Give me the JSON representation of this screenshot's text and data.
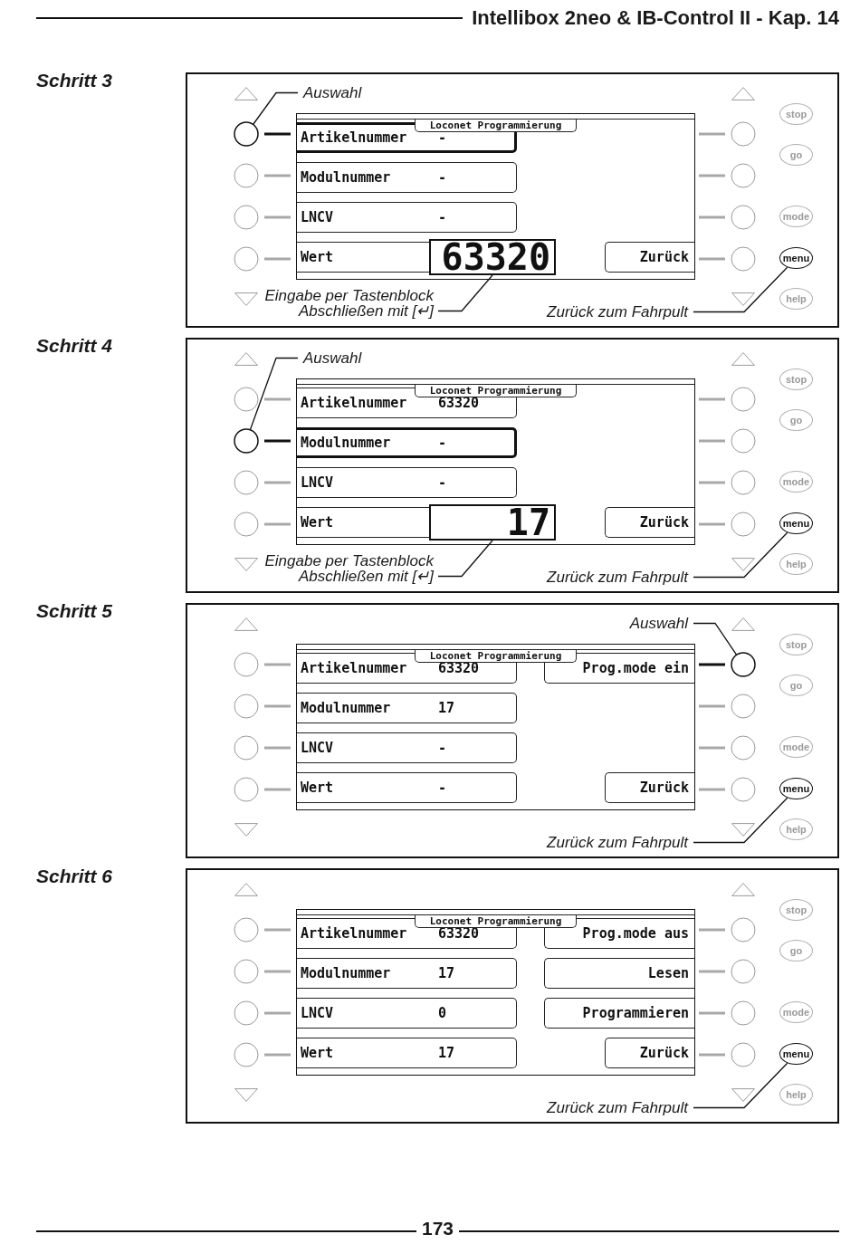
{
  "header": {
    "title": "Intellibox 2neo & IB-Control II - Kap. 14"
  },
  "steps": [
    {
      "label": "Schritt 3",
      "screen": {
        "title": "Loconet Programmierung",
        "rows": [
          {
            "kind": "field",
            "label": "Artikelnummer",
            "value": "-",
            "selected": true
          },
          {
            "kind": "field",
            "label": "Modulnummer",
            "value": "-",
            "selected": false
          },
          {
            "kind": "field",
            "label": "LNCV",
            "value": "-",
            "selected": false
          },
          {
            "kind": "entry",
            "label": "Wert",
            "value": "63320",
            "selected": false
          }
        ],
        "softkeys": [
          {
            "kind": "empty"
          },
          {
            "kind": "empty"
          },
          {
            "kind": "empty"
          },
          {
            "kind": "back",
            "label": "Zurück"
          }
        ]
      },
      "left_keys": [
        {
          "highlighted": true
        },
        {
          "highlighted": false
        },
        {
          "highlighted": false
        },
        {
          "highlighted": false
        }
      ],
      "right_keys": [
        {
          "highlighted": false
        },
        {
          "highlighted": false
        },
        {
          "highlighted": false
        },
        {
          "highlighted": false
        }
      ],
      "side_buttons": [
        {
          "label": "stop",
          "highlighted": false
        },
        {
          "label": "go",
          "highlighted": false
        },
        {
          "label": "mode",
          "highlighted": false
        },
        {
          "label": "menu",
          "highlighted": true
        },
        {
          "label": "help",
          "highlighted": false
        }
      ],
      "callouts": [
        {
          "kind": "selection",
          "text": "Auswahl"
        },
        {
          "kind": "entry",
          "lines": [
            "Eingabe per Tastenblock",
            "Abschließen mit [↵]"
          ]
        },
        {
          "kind": "exit",
          "text": "Zurück zum Fahrpult"
        }
      ]
    },
    {
      "label": "Schritt 4",
      "screen": {
        "title": "Loconet Programmierung",
        "rows": [
          {
            "kind": "field",
            "label": "Artikelnummer",
            "value": "63320",
            "selected": false
          },
          {
            "kind": "field",
            "label": "Modulnummer",
            "value": "-",
            "selected": true
          },
          {
            "kind": "field",
            "label": "LNCV",
            "value": "-",
            "selected": false
          },
          {
            "kind": "entry",
            "label": "Wert",
            "value": "17",
            "selected": false
          }
        ],
        "softkeys": [
          {
            "kind": "empty"
          },
          {
            "kind": "empty"
          },
          {
            "kind": "empty"
          },
          {
            "kind": "back",
            "label": "Zurück"
          }
        ]
      },
      "left_keys": [
        {
          "highlighted": false
        },
        {
          "highlighted": true
        },
        {
          "highlighted": false
        },
        {
          "highlighted": false
        }
      ],
      "right_keys": [
        {
          "highlighted": false
        },
        {
          "highlighted": false
        },
        {
          "highlighted": false
        },
        {
          "highlighted": false
        }
      ],
      "side_buttons": [
        {
          "label": "stop",
          "highlighted": false
        },
        {
          "label": "go",
          "highlighted": false
        },
        {
          "label": "mode",
          "highlighted": false
        },
        {
          "label": "menu",
          "highlighted": true
        },
        {
          "label": "help",
          "highlighted": false
        }
      ],
      "callouts": [
        {
          "kind": "selection",
          "text": "Auswahl"
        },
        {
          "kind": "entry",
          "lines": [
            "Eingabe per Tastenblock",
            "Abschließen mit [↵]"
          ]
        },
        {
          "kind": "exit",
          "text": "Zurück zum Fahrpult"
        }
      ]
    },
    {
      "label": "Schritt 5",
      "screen": {
        "title": "Loconet Programmierung",
        "rows": [
          {
            "kind": "field",
            "label": "Artikelnummer",
            "value": "63320",
            "selected": false
          },
          {
            "kind": "field",
            "label": "Modulnummer",
            "value": "17",
            "selected": false
          },
          {
            "kind": "field",
            "label": "LNCV",
            "value": "-",
            "selected": false
          },
          {
            "kind": "field",
            "label": "Wert",
            "value": "-",
            "selected": false
          }
        ],
        "softkeys": [
          {
            "kind": "action",
            "label": "Prog.mode ein"
          },
          {
            "kind": "empty"
          },
          {
            "kind": "empty"
          },
          {
            "kind": "back",
            "label": "Zurück"
          }
        ]
      },
      "left_keys": [
        {
          "highlighted": false
        },
        {
          "highlighted": false
        },
        {
          "highlighted": false
        },
        {
          "highlighted": false
        }
      ],
      "right_keys": [
        {
          "highlighted": true
        },
        {
          "highlighted": false
        },
        {
          "highlighted": false
        },
        {
          "highlighted": false
        }
      ],
      "side_buttons": [
        {
          "label": "stop",
          "highlighted": false
        },
        {
          "label": "go",
          "highlighted": false
        },
        {
          "label": "mode",
          "highlighted": false
        },
        {
          "label": "menu",
          "highlighted": true
        },
        {
          "label": "help",
          "highlighted": false
        }
      ],
      "callouts": [
        {
          "kind": "selection",
          "text": "Auswahl"
        },
        {
          "kind": "exit",
          "text": "Zurück zum Fahrpult"
        }
      ]
    },
    {
      "label": "Schritt 6",
      "screen": {
        "title": "Loconet Programmierung",
        "rows": [
          {
            "kind": "field",
            "label": "Artikelnummer",
            "value": "63320",
            "selected": false
          },
          {
            "kind": "field",
            "label": "Modulnummer",
            "value": "17",
            "selected": false
          },
          {
            "kind": "field",
            "label": "LNCV",
            "value": "0",
            "selected": false
          },
          {
            "kind": "field",
            "label": "Wert",
            "value": "17",
            "selected": false
          }
        ],
        "softkeys": [
          {
            "kind": "action",
            "label": "Prog.mode aus"
          },
          {
            "kind": "action",
            "label": "Lesen"
          },
          {
            "kind": "action",
            "label": "Programmieren"
          },
          {
            "kind": "back",
            "label": "Zurück"
          }
        ]
      },
      "left_keys": [
        {
          "highlighted": false
        },
        {
          "highlighted": false
        },
        {
          "highlighted": false
        },
        {
          "highlighted": false
        }
      ],
      "right_keys": [
        {
          "highlighted": false
        },
        {
          "highlighted": false
        },
        {
          "highlighted": false
        },
        {
          "highlighted": false
        }
      ],
      "side_buttons": [
        {
          "label": "stop",
          "highlighted": false
        },
        {
          "label": "go",
          "highlighted": false
        },
        {
          "label": "mode",
          "highlighted": false
        },
        {
          "label": "menu",
          "highlighted": true
        },
        {
          "label": "help",
          "highlighted": false
        }
      ],
      "callouts": [
        {
          "kind": "exit",
          "text": "Zurück zum Fahrpult"
        }
      ]
    }
  ],
  "footer": {
    "page": "173"
  }
}
